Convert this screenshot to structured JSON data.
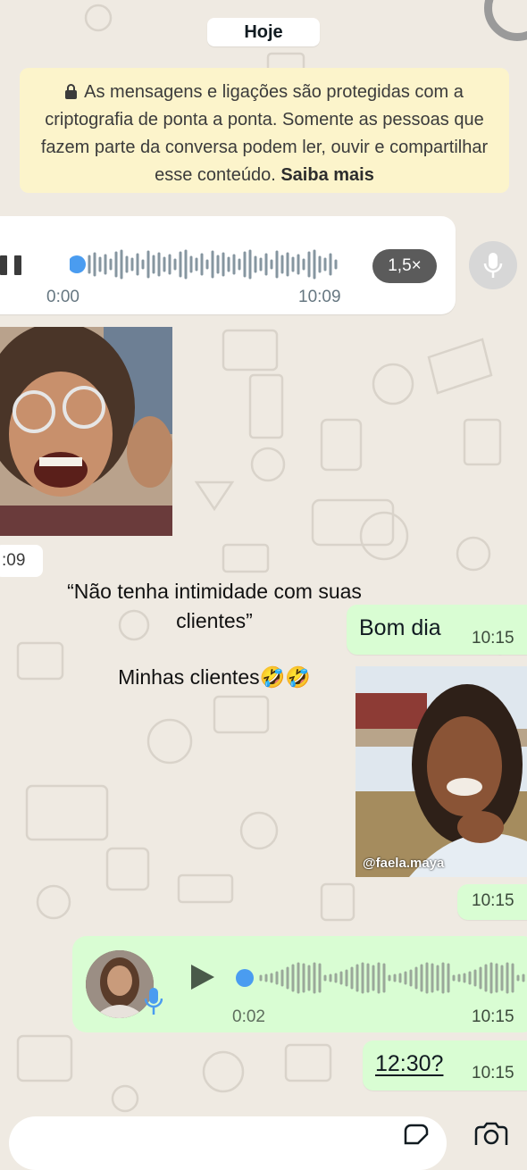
{
  "date_separator": "Hoje",
  "encryption_notice": {
    "text": "As mensagens e ligações são protegidas com a criptografia de ponta a ponta. Somente as pessoas que fazem parte da conversa podem ler, ouvir e compartilhar esse conteúdo.",
    "link": "Saiba mais"
  },
  "incoming_voice": {
    "elapsed": "0:00",
    "duration": "10:09",
    "speed": "1,5×",
    "progress": 0.0
  },
  "incoming_photo": {
    "time": ":09"
  },
  "caption": {
    "quote": "“Não tenha intimidade com suas clientes”",
    "punchline": "Minhas clientes🤣🤣"
  },
  "outgoing_messages": [
    {
      "text": "Bom dia",
      "time": "10:15"
    },
    {
      "time": "10:15",
      "watermark": "@faela.maya"
    },
    {
      "elapsed": "0:02",
      "time": "10:15"
    },
    {
      "text": "12:30?",
      "time": "10:15"
    }
  ],
  "colors": {
    "background": "#efeae2",
    "outgoing_bubble": "#d9fdd3",
    "incoming_bubble": "#ffffff",
    "encryption_bubble": "#fcf4cb",
    "accent_blue": "#4a9cf0"
  },
  "icons": [
    "pause-icon",
    "mic-icon",
    "play-icon",
    "lock-icon",
    "sticker-icon",
    "camera-icon"
  ]
}
